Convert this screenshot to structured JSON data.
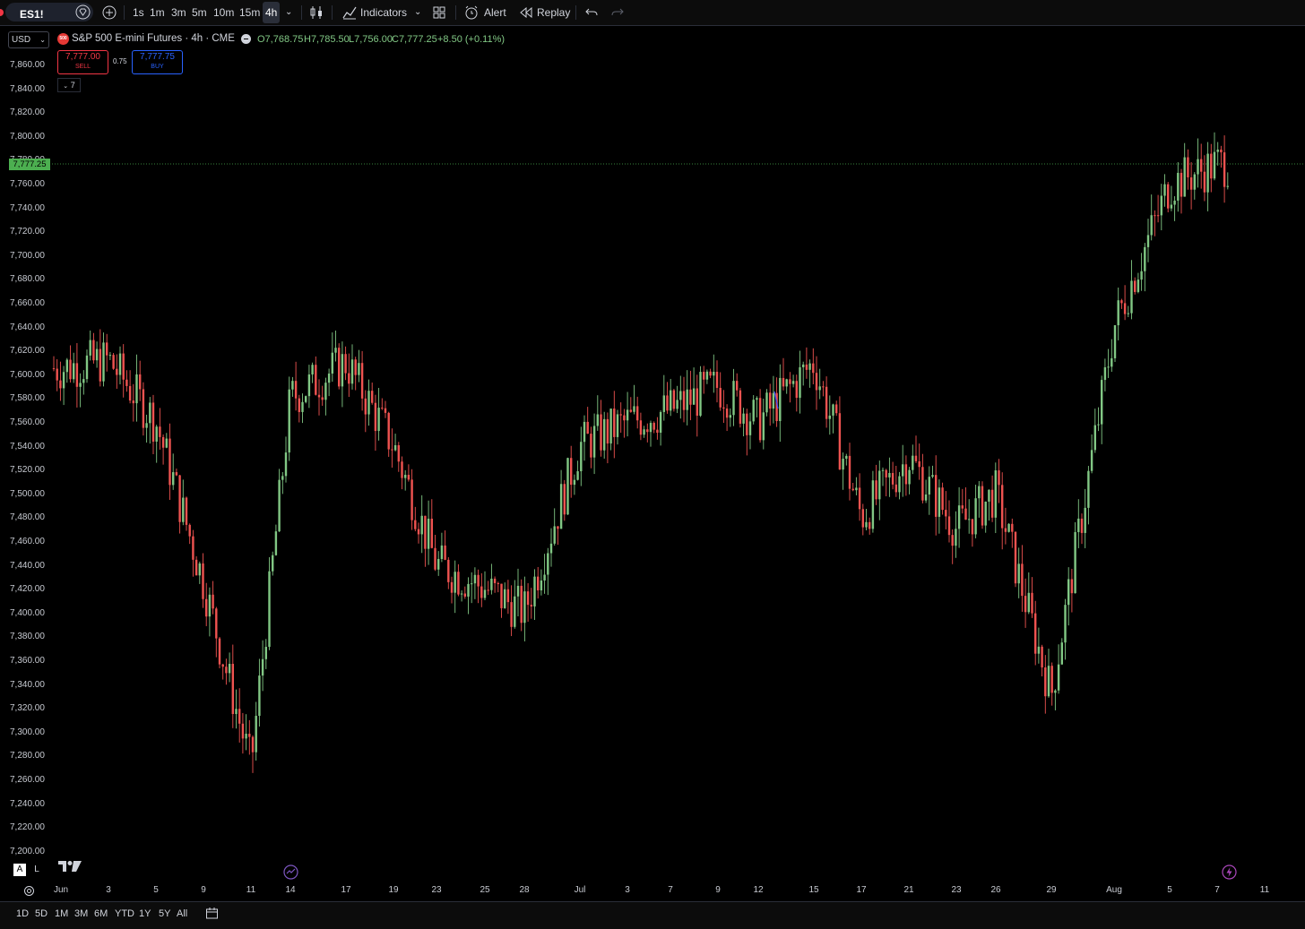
{
  "toolbar": {
    "symbol": "ES1!",
    "timeframes": [
      "1s",
      "1m",
      "3m",
      "5m",
      "10m",
      "15m",
      "4h"
    ],
    "active_timeframe": "4h",
    "indicators_label": "Indicators",
    "alert_label": "Alert",
    "replay_label": "Replay"
  },
  "currency": "USD",
  "legend": {
    "logo": "500",
    "title": "S&P 500 E-mini Futures · 4h · CME",
    "open": "O7,768.75",
    "high": "H7,785.50",
    "low": "L7,756.00",
    "close": "C7,777.25",
    "change": "+8.50 (+0.11%)",
    "sell_price": "7,777.00",
    "sell_label": "SELL",
    "spread": "0.75",
    "buy_price": "7,777.75",
    "buy_label": "BUY",
    "indicators_toggle": "7"
  },
  "last_price": "7,777.25",
  "y_axis_labels": [
    "7,860.00",
    "7,840.00",
    "7,820.00",
    "7,800.00",
    "7,780.00",
    "7,760.00",
    "7,740.00",
    "7,720.00",
    "7,700.00",
    "7,680.00",
    "7,660.00",
    "7,640.00",
    "7,620.00",
    "7,600.00",
    "7,580.00",
    "7,560.00",
    "7,540.00",
    "7,520.00",
    "7,500.00",
    "7,480.00",
    "7,460.00",
    "7,440.00",
    "7,420.00",
    "7,400.00",
    "7,380.00",
    "7,360.00",
    "7,340.00",
    "7,320.00",
    "7,300.00",
    "7,280.00",
    "7,260.00",
    "7,240.00",
    "7,220.00",
    "7,200.00"
  ],
  "x_axis_labels": [
    "Jun",
    "3",
    "5",
    "9",
    "11",
    "14",
    "17",
    "19",
    "23",
    "25",
    "28",
    "Jul",
    "3",
    "7",
    "9",
    "12",
    "15",
    "17",
    "21",
    "23",
    "26",
    "29",
    "Aug",
    "5",
    "7",
    "11"
  ],
  "scale_buttons": [
    "A",
    "L"
  ],
  "range_buttons": [
    "1D",
    "5D",
    "1M",
    "3M",
    "6M",
    "YTD",
    "1Y",
    "5Y",
    "All"
  ],
  "colors": {
    "up": "#26a69a",
    "up_bright": "#81c784",
    "down": "#ef5350",
    "last_price_bg": "#4caf50"
  },
  "chart_data": {
    "type": "candlestick",
    "ylim": [
      7200,
      7860
    ],
    "x": [
      "Jun",
      "3",
      "5",
      "9",
      "11",
      "14",
      "17",
      "19",
      "23",
      "25",
      "28",
      "Jul",
      "3",
      "7",
      "9",
      "12",
      "15",
      "17",
      "21",
      "23",
      "26",
      "29",
      "Aug",
      "5",
      "7"
    ],
    "close": [
      7605,
      7612,
      7560,
      7425,
      7270,
      7580,
      7610,
      7540,
      7440,
      7420,
      7400,
      7540,
      7560,
      7570,
      7590,
      7560,
      7610,
      7480,
      7530,
      7470,
      7500,
      7330,
      7640,
      7760,
      7777
    ]
  }
}
